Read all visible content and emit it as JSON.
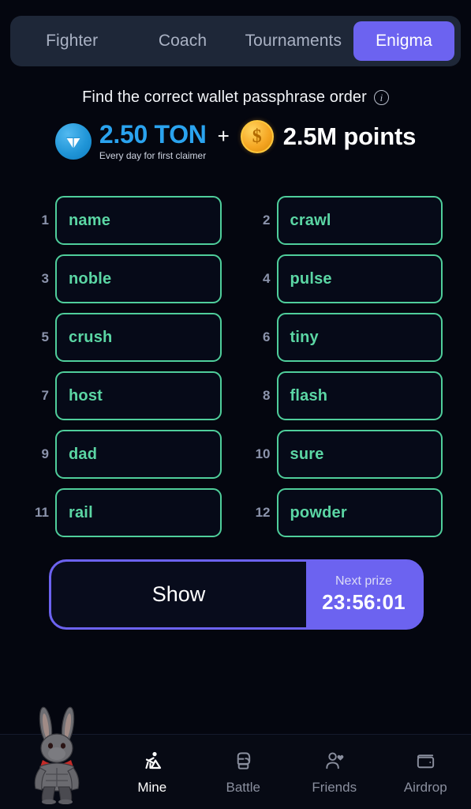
{
  "tabs": [
    {
      "label": "Fighter",
      "active": false
    },
    {
      "label": "Coach",
      "active": false
    },
    {
      "label": "Tournaments",
      "active": false
    },
    {
      "label": "Enigma",
      "active": true
    }
  ],
  "header": {
    "title": "Find the correct wallet passphrase order",
    "info_icon": "info-icon"
  },
  "prize": {
    "ton_icon": "ton-coin-icon",
    "ton_amount": "2.50 TON",
    "ton_subtitle": "Every day for first claimer",
    "separator": "+",
    "points_icon": "gold-coin-icon",
    "points_amount": "2.5M points",
    "ton_color": "#2aa3ef",
    "points_color": "#ffffff"
  },
  "grid": {
    "border_color": "#4fce9b",
    "text_color": "#5bd6a4",
    "words": [
      {
        "num": "1",
        "word": "name"
      },
      {
        "num": "2",
        "word": "crawl"
      },
      {
        "num": "3",
        "word": "noble"
      },
      {
        "num": "4",
        "word": "pulse"
      },
      {
        "num": "5",
        "word": "crush"
      },
      {
        "num": "6",
        "word": "tiny"
      },
      {
        "num": "7",
        "word": "host"
      },
      {
        "num": "8",
        "word": "flash"
      },
      {
        "num": "9",
        "word": "dad"
      },
      {
        "num": "10",
        "word": "sure"
      },
      {
        "num": "11",
        "word": "rail"
      },
      {
        "num": "12",
        "word": "powder"
      }
    ]
  },
  "action": {
    "show_label": "Show",
    "timer_label": "Next prize",
    "timer_value": "23:56:01",
    "accent_color": "#6c63f0"
  },
  "mascot": {
    "icon": "rabbit-fighter-mascot"
  },
  "bottom_nav": [
    {
      "label": "Mine",
      "icon": "pickaxe-miner-icon",
      "active": true
    },
    {
      "label": "Battle",
      "icon": "boxing-glove-icon",
      "active": false
    },
    {
      "label": "Friends",
      "icon": "person-heart-icon",
      "active": false
    },
    {
      "label": "Airdrop",
      "icon": "wallet-icon",
      "active": false
    }
  ]
}
